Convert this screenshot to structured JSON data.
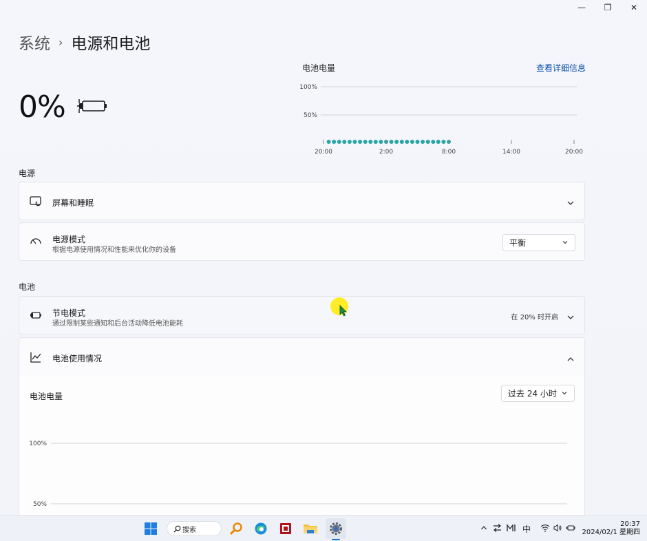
{
  "window": {
    "minimize": "—",
    "maximize": "❐",
    "close": "✕"
  },
  "breadcrumb": {
    "parent": "系统",
    "separator": "›",
    "current": "电源和电池"
  },
  "battery": {
    "percent": "0%",
    "icon": "battery-plugged-icon"
  },
  "mini_chart": {
    "title": "电池电量",
    "link": "查看详细信息"
  },
  "chart_data": [
    {
      "type": "scatter",
      "title": "电池电量",
      "x_ticks": [
        "20:00",
        "2:00",
        "8:00",
        "14:00",
        "20:00"
      ],
      "y_ticks": [
        "100%",
        "50%"
      ],
      "ylim": [
        0,
        100
      ],
      "x": [
        0.5,
        1,
        1.5,
        2,
        2.5,
        3,
        3.5,
        4,
        4.5,
        5,
        5.5,
        6,
        6.5,
        7,
        7.5,
        8,
        8.5,
        9,
        9.5,
        10,
        10.5,
        11,
        11.5,
        12
      ],
      "values": [
        0,
        0,
        0,
        0,
        0,
        0,
        0,
        0,
        0,
        0,
        0,
        0,
        0,
        0,
        0,
        0,
        0,
        0,
        0,
        0,
        0,
        0,
        0,
        0
      ],
      "xlim": [
        0,
        24
      ],
      "grid": true,
      "color": "#2aa5a5"
    },
    {
      "type": "bar",
      "title": "电池电量",
      "y_ticks": [
        "100%",
        "50%"
      ],
      "ylim": [
        0,
        100
      ],
      "grid": true
    }
  ],
  "sections": {
    "power": "电源",
    "battery": "电池"
  },
  "cards": {
    "screen_sleep": {
      "title": "屏幕和睡眠"
    },
    "power_mode": {
      "title": "电源模式",
      "subtitle": "根据电源使用情况和性能来优化你的设备",
      "value": "平衡"
    },
    "saver": {
      "title": "节电模式",
      "subtitle": "通过限制某些通知和后台活动降低电池能耗",
      "status": "在 20% 时开启"
    },
    "usage": {
      "title": "电池使用情况"
    }
  },
  "usage_panel": {
    "title": "电池电量",
    "range": "过去 24 小时"
  },
  "taskbar": {
    "search_label": "搜索",
    "tray_lang": "中",
    "time": "20:37",
    "date": "2024/02/1 星期四"
  },
  "colors": {
    "accent": "#0a4fa8",
    "dots": "#2aa5a5"
  }
}
